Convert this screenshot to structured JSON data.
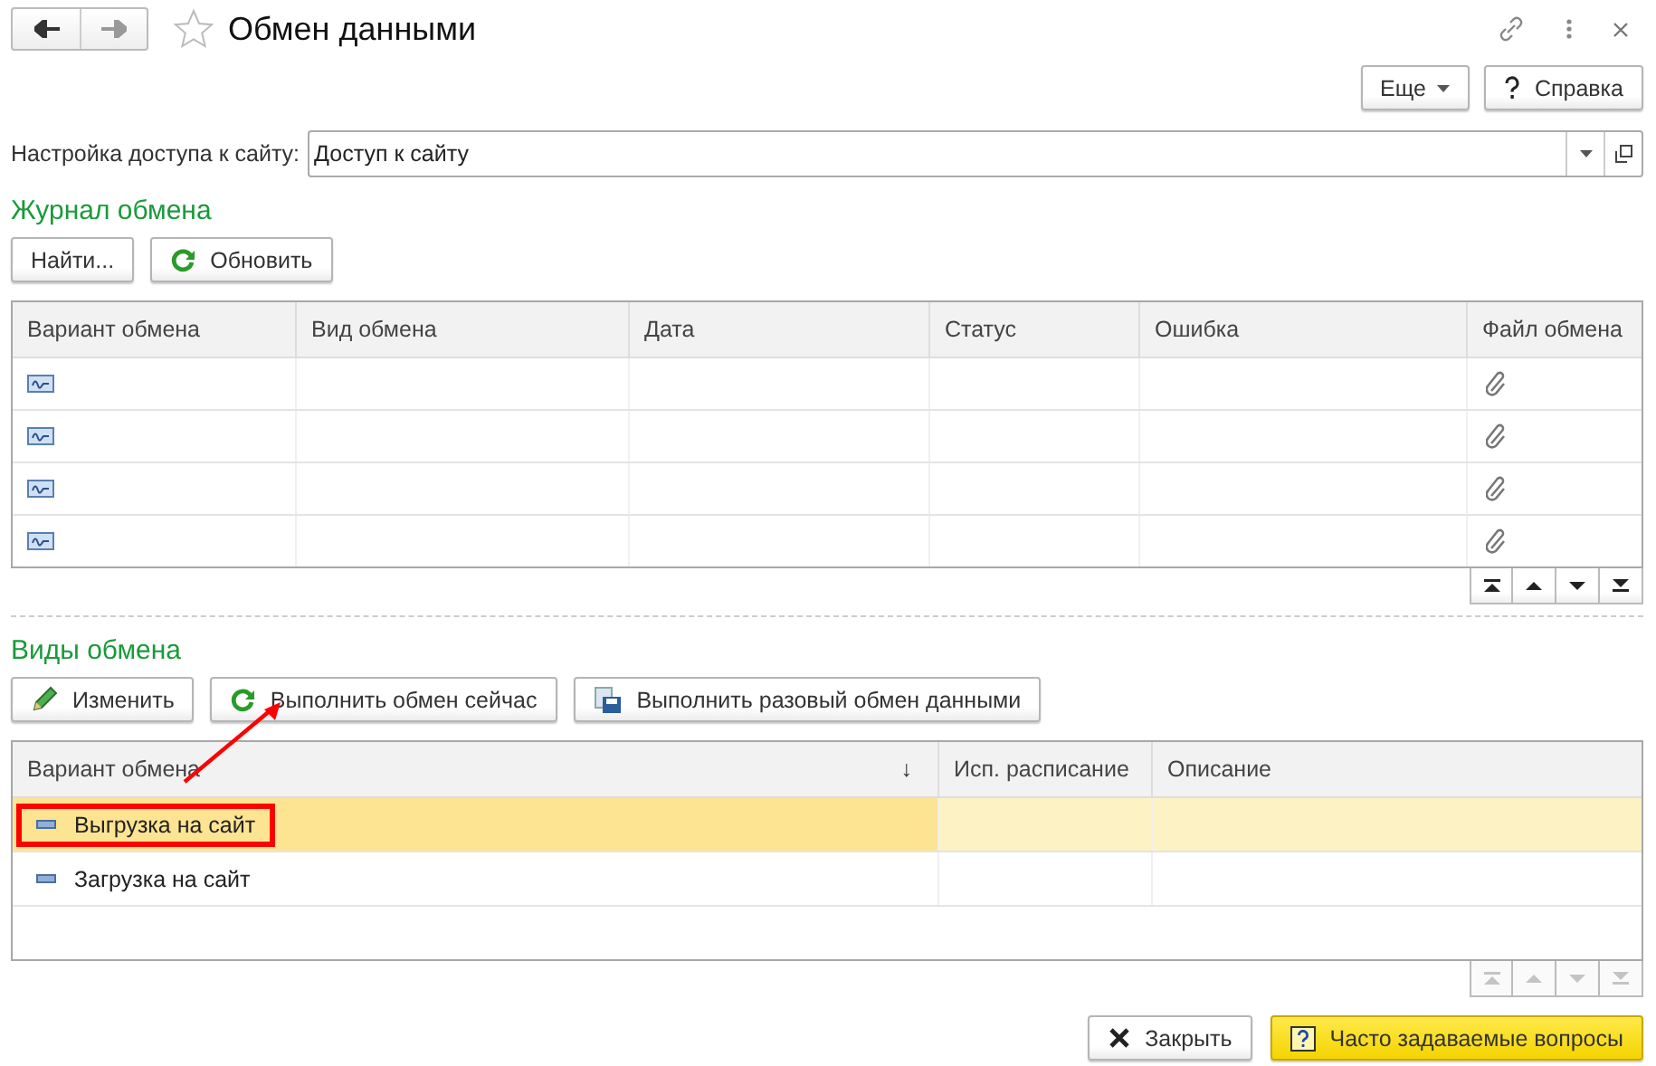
{
  "window": {
    "title": "Обмен данными",
    "favorite": false
  },
  "header_buttons": [
    {
      "label": "Еще",
      "kind": "more"
    },
    {
      "label": "Справка",
      "kind": "help"
    }
  ],
  "access": {
    "label": "Настройка доступа к сайту:",
    "value": "Доступ к сайту"
  },
  "journal": {
    "title": "Журнал обмена",
    "buttons": [
      {
        "label": "Найти...",
        "kind": "plain"
      },
      {
        "label": "Обновить",
        "kind": "refresh"
      }
    ],
    "columns": [
      "Вариант обмена",
      "Вид обмена",
      "Дата",
      "Статус",
      "Ошибка",
      "Файл обмена"
    ],
    "rows": [
      {
        "has_file": true
      },
      {
        "has_file": true
      },
      {
        "has_file": true
      },
      {
        "has_file": true
      }
    ],
    "nav_disabled": false
  },
  "kinds": {
    "title": "Виды обмена",
    "buttons": [
      {
        "label": "Изменить",
        "kind": "edit"
      },
      {
        "label": "Выполнить обмен сейчас",
        "kind": "refresh"
      },
      {
        "label": "Выполнить разовый обмен данными",
        "kind": "save"
      }
    ],
    "columns": [
      {
        "label": "Вариант обмена",
        "sort": "↓"
      },
      {
        "label": "Исп. расписание"
      },
      {
        "label": "Описание"
      }
    ],
    "rows": [
      {
        "name": "Выгрузка на сайт",
        "selected": true,
        "highlighted": true
      },
      {
        "name": "Загрузка на сайт",
        "selected": false,
        "highlighted": false
      }
    ],
    "nav_disabled": true
  },
  "footer_buttons": [
    {
      "label": "Закрыть",
      "kind": "close"
    },
    {
      "label": "Часто задаваемые вопросы",
      "kind": "faq"
    }
  ]
}
